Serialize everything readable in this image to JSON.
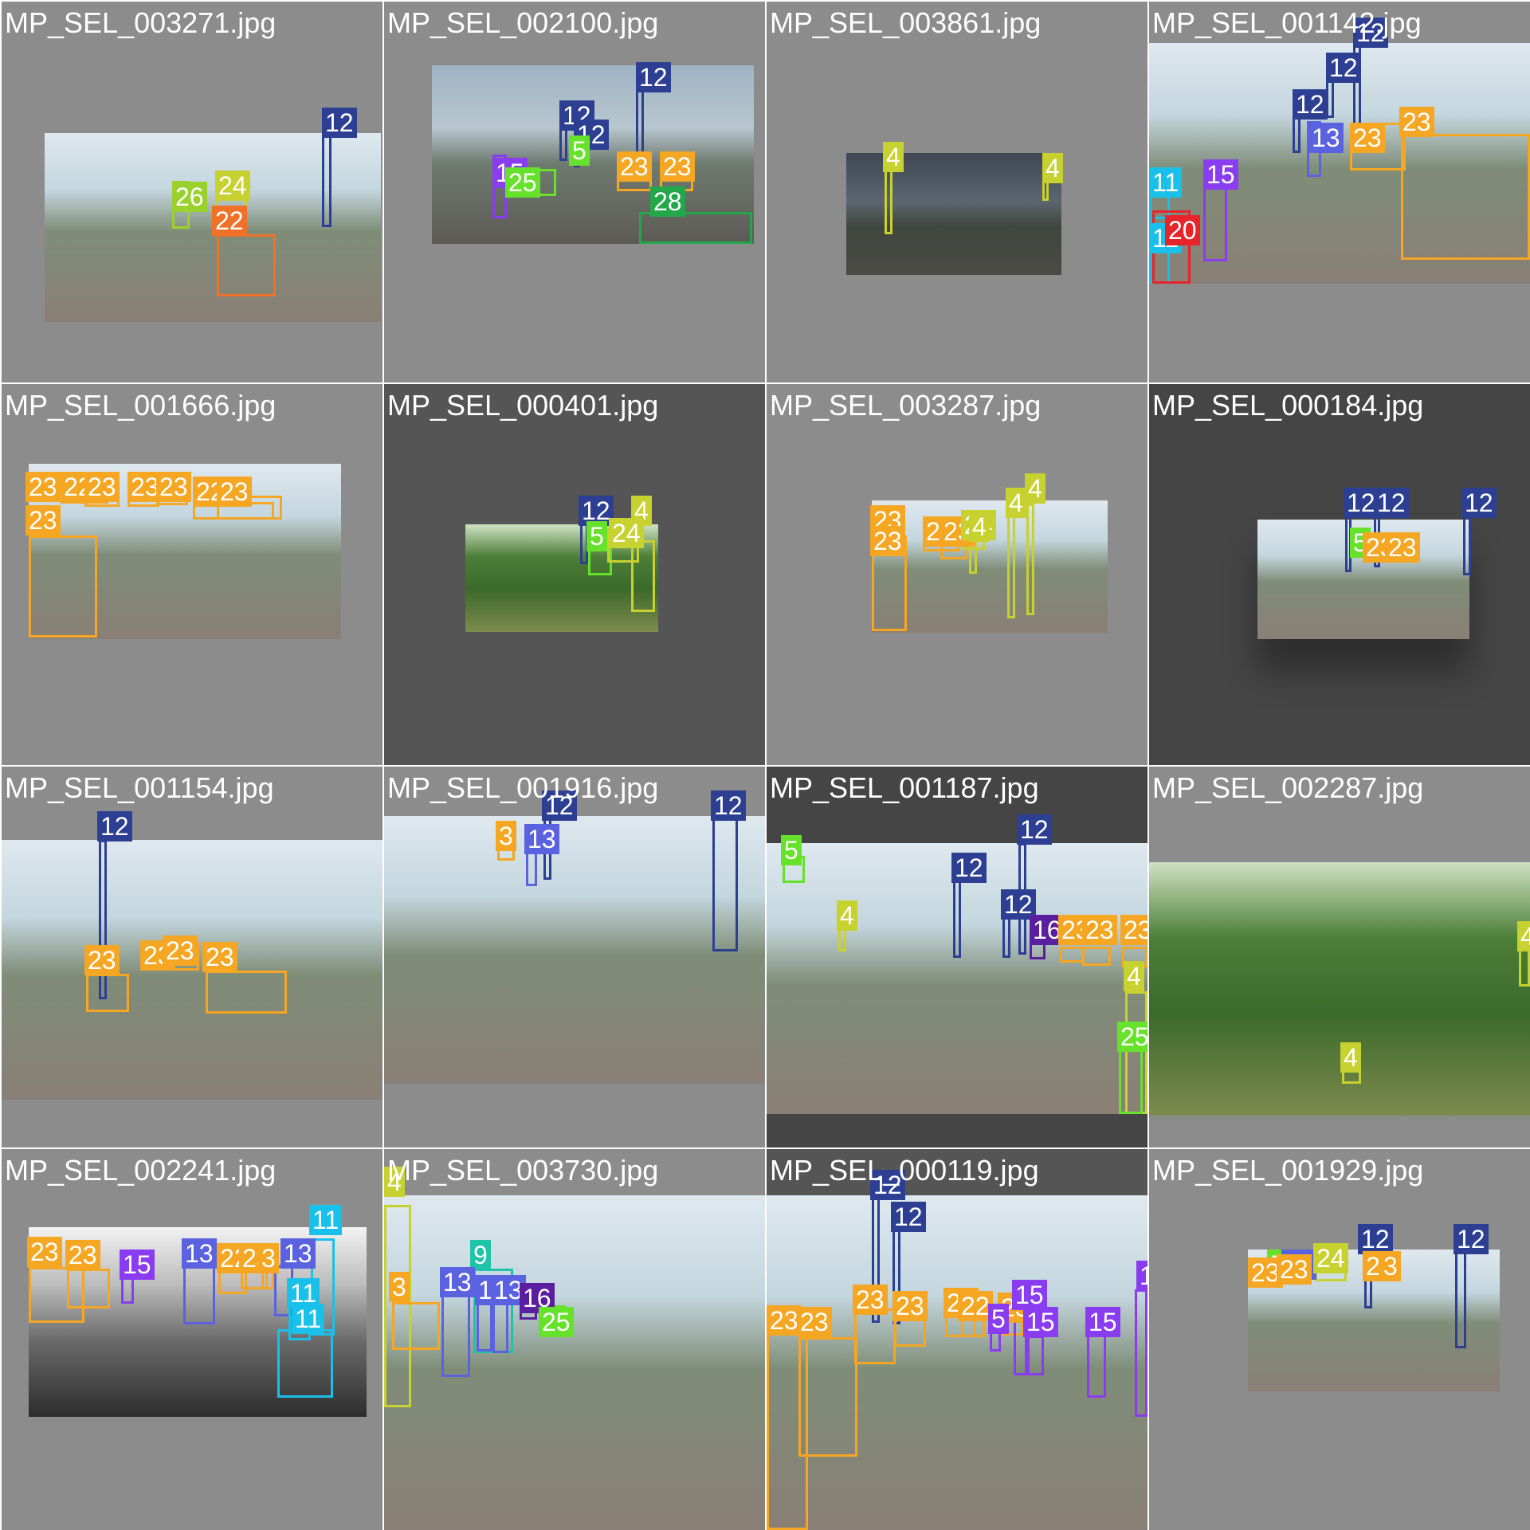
{
  "class_colors": {
    "3": "#f5a623",
    "4": "#c7d12f",
    "5": "#66e22b",
    "9": "#1fc3a8",
    "11": "#19c0ea",
    "12": "#2d3f92",
    "13": "#5b62e0",
    "15": "#8a3cf0",
    "16": "#5a1ea0",
    "20": "#e8242b",
    "22": "#f07228",
    "23": "#f5a623",
    "24": "#c7d12f",
    "25": "#66e22b",
    "26": "#9bd12c",
    "28": "#22a84a"
  },
  "tiles": [
    {
      "filename": "MP_SEL_003271.jpg",
      "labels": [
        "12",
        "26",
        "24",
        "22"
      ]
    },
    {
      "filename": "MP_SEL_002100.jpg",
      "labels": [
        "12",
        "12",
        "12",
        "15",
        "5",
        "25",
        "23",
        "23",
        "28"
      ]
    },
    {
      "filename": "MP_SEL_003861.jpg",
      "labels": [
        "4",
        "4"
      ]
    },
    {
      "filename": "MP_SEL_001142.jpg",
      "labels": [
        "12",
        "12",
        "12",
        "13",
        "23",
        "23",
        "11",
        "15",
        "11",
        "20"
      ]
    },
    {
      "filename": "MP_SEL_001666.jpg",
      "labels": [
        "23",
        "22",
        "23",
        "23",
        "23",
        "22",
        "23",
        "23"
      ]
    },
    {
      "filename": "MP_SEL_000401.jpg",
      "labels": [
        "12",
        "4",
        "5",
        "24"
      ]
    },
    {
      "filename": "MP_SEL_003287.jpg",
      "labels": [
        "23",
        "23",
        "22",
        "23",
        "24",
        "4",
        "4",
        "4"
      ]
    },
    {
      "filename": "MP_SEL_000184.jpg",
      "labels": [
        "12",
        "12",
        "12",
        "5",
        "23",
        "23"
      ]
    },
    {
      "filename": "MP_SEL_001154.jpg",
      "labels": [
        "12",
        "23",
        "23",
        "23",
        "23"
      ]
    },
    {
      "filename": "MP_SEL_001916.jpg",
      "labels": [
        "3",
        "12",
        "13",
        "12"
      ]
    },
    {
      "filename": "MP_SEL_001187.jpg",
      "labels": [
        "5",
        "12",
        "12",
        "4",
        "12",
        "16",
        "23",
        "23",
        "23",
        "4",
        "25"
      ]
    },
    {
      "filename": "MP_SEL_002287.jpg",
      "labels": [
        "4",
        "4"
      ]
    },
    {
      "filename": "MP_SEL_002241.jpg",
      "labels": [
        "23",
        "23",
        "15",
        "13",
        "22",
        "23",
        "3",
        "13",
        "11",
        "11",
        "11"
      ]
    },
    {
      "filename": "MP_SEL_003730.jpg",
      "labels": [
        "4",
        "3",
        "9",
        "13",
        "11",
        "13",
        "16",
        "25"
      ]
    },
    {
      "filename": "MP_SEL_000119.jpg",
      "labels": [
        "12",
        "12",
        "23",
        "23",
        "23",
        "23",
        "23",
        "22",
        "23",
        "5",
        "15",
        "15",
        "15",
        "15"
      ]
    },
    {
      "filename": "MP_SEL_001929.jpg",
      "labels": [
        "5",
        "13",
        "12",
        "12",
        "23",
        "23",
        "24",
        "23",
        "3"
      ]
    }
  ]
}
